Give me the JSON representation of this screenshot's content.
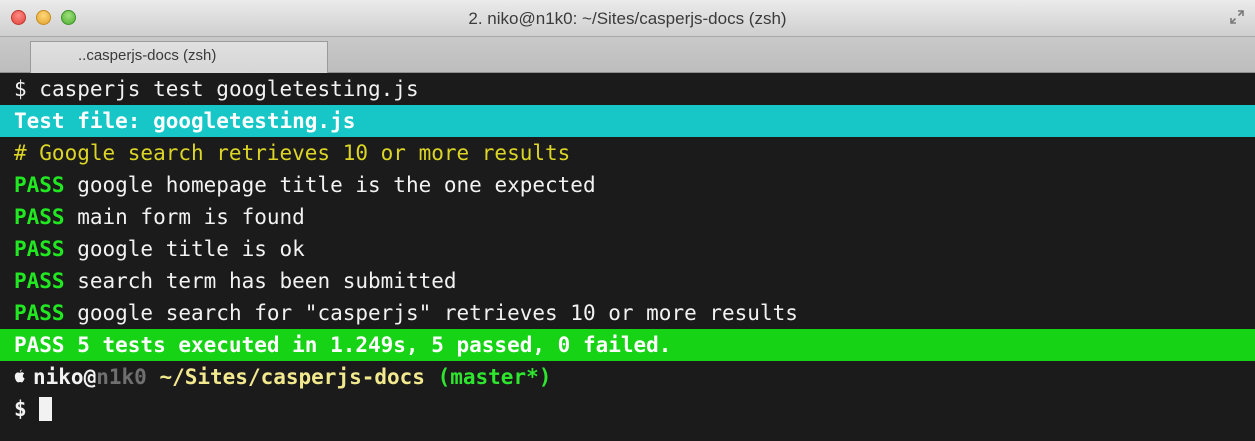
{
  "window": {
    "title": "2. niko@n1k0: ~/Sites/casperjs-docs (zsh)",
    "tab_label": "..casperjs-docs (zsh)",
    "icons": [
      "close-button",
      "minimize-button",
      "zoom-button",
      "fullscreen-icon"
    ]
  },
  "terminal": {
    "command_prompt": "$ ",
    "command": "casperjs test googletesting.js",
    "test_file_line": "Test file: googletesting.js",
    "suite_header": "# Google search retrieves 10 or more results",
    "pass_label": "PASS",
    "results": [
      " google homepage title is the one expected",
      " main form is found",
      " google title is ok",
      " search term has been submitted",
      " google search for \"casperjs\" retrieves 10 or more results"
    ],
    "summary": "PASS 5 tests executed in 1.249s, 5 passed, 0 failed.",
    "prompt": {
      "user": "niko@",
      "host": "n1k0",
      "path": " ~/Sites/casperjs-docs",
      "branch": " (master*)",
      "symbol": "$ "
    }
  },
  "colors": {
    "background": "#1b1b1b",
    "cyan_highlight": "#17c7c7",
    "green_highlight": "#16d316",
    "pass_green": "#22e822",
    "yellow": "#dcd526"
  }
}
